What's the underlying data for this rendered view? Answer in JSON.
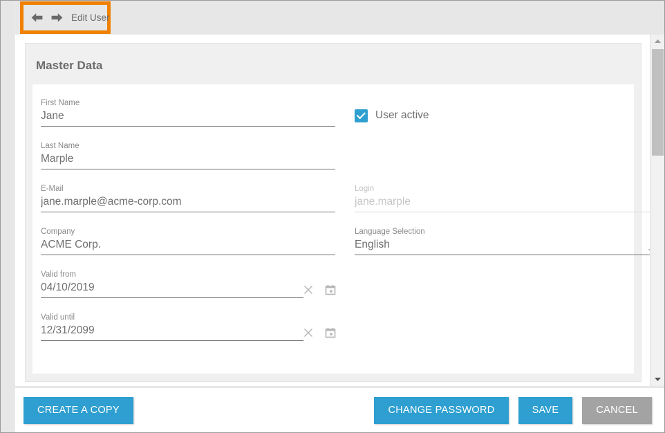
{
  "topbar": {
    "back_icon": "arrow-left-icon",
    "forward_icon": "arrow-right-icon",
    "title": "Edit User",
    "highlight_color": "#f08000"
  },
  "card": {
    "title": "Master Data"
  },
  "form": {
    "left_fields": [
      {
        "name": "first-name",
        "label": "First Name",
        "value": "Jane",
        "type": "text",
        "disabled": false
      },
      {
        "name": "last-name",
        "label": "Last Name",
        "value": "Marple",
        "type": "text",
        "disabled": false
      },
      {
        "name": "email",
        "label": "E-Mail",
        "value": "jane.marple@acme-corp.com",
        "type": "text",
        "disabled": false
      },
      {
        "name": "company",
        "label": "Company",
        "value": "ACME Corp.",
        "type": "text",
        "disabled": false
      },
      {
        "name": "valid-from",
        "label": "Valid from",
        "value": "04/10/2019",
        "type": "date",
        "disabled": false
      },
      {
        "name": "valid-until",
        "label": "Valid until",
        "value": "12/31/2099",
        "type": "date",
        "disabled": false
      }
    ],
    "checkbox": {
      "label": "User active",
      "checked": true,
      "color": "#2e9fd0"
    },
    "right_fields": [
      {
        "name": "login",
        "label": "Login",
        "value": "jane.marple",
        "type": "text",
        "disabled": true
      },
      {
        "name": "language-selection",
        "label": "Language Selection",
        "value": "English",
        "type": "select",
        "disabled": false
      }
    ],
    "date_icons": {
      "clear": "clear-x-icon",
      "calendar": "calendar-icon"
    },
    "select_icon": "chevron-down-icon"
  },
  "footer": {
    "create_copy_label": "CREATE A COPY",
    "change_password_label": "CHANGE PASSWORD",
    "save_label": "SAVE",
    "cancel_label": "CANCEL",
    "primary_color": "#2e9fd0",
    "secondary_color": "#a3a3a3"
  },
  "scrollbar": {
    "up_icon": "scroll-up-arrow-icon",
    "down_icon": "scroll-down-arrow-icon",
    "thumb": "scroll-thumb"
  }
}
